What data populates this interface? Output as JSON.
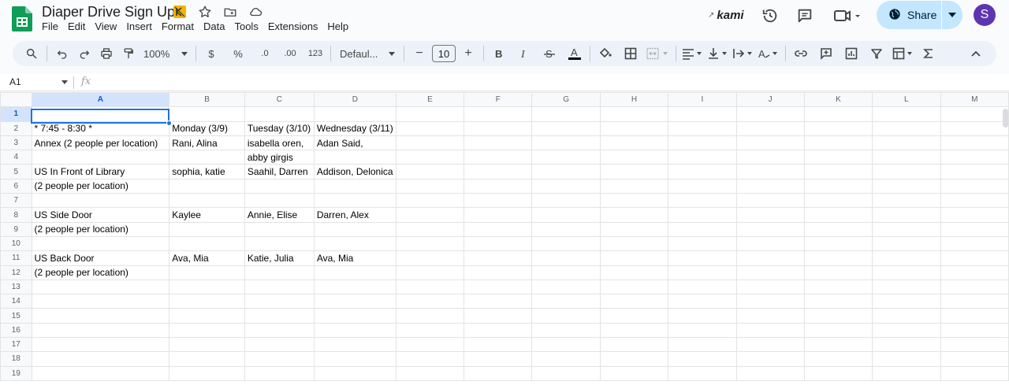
{
  "app": {
    "doc_title": "Diaper Drive Sign Ups",
    "menus": [
      "File",
      "Edit",
      "View",
      "Insert",
      "Format",
      "Data",
      "Tools",
      "Extensions",
      "Help"
    ],
    "kami_label": "kami",
    "share_label": "Share",
    "avatar_letter": "S",
    "accent": "#1a73e8"
  },
  "toolbar": {
    "zoom": "100%",
    "currency": "$",
    "percent": "%",
    "decrease_decimal": ".0",
    "increase_decimal": ".00",
    "number_format": "123",
    "font": "Defaul...",
    "font_size": "10",
    "minus": "−",
    "plus": "+"
  },
  "formula_bar": {
    "name_box": "A1",
    "fx": "fx",
    "value": ""
  },
  "sheet": {
    "columns": [
      "A",
      "B",
      "C",
      "D",
      "E",
      "F",
      "G",
      "H",
      "I",
      "J",
      "K",
      "L",
      "M"
    ],
    "rows": [
      [
        "",
        "",
        "",
        ""
      ],
      [
        "* 7:45 - 8:30 *",
        "Monday (3/9)",
        "Tuesday (3/10)",
        "Wednesday (3/11)"
      ],
      [
        "Annex (2 people per location)",
        "Rani, Alina",
        "isabella oren,",
        "Adan Said,"
      ],
      [
        "",
        "",
        "abby girgis",
        ""
      ],
      [
        "US In Front of Library",
        "sophia, katie",
        "Saahil, Darren",
        "Addison, Delonica"
      ],
      [
        "(2 people per location)",
        "",
        "",
        ""
      ],
      [
        "",
        "",
        "",
        ""
      ],
      [
        "US Side Door",
        "Kaylee",
        "Annie, Elise",
        "Darren, Alex"
      ],
      [
        "(2 people per location)",
        "",
        "",
        ""
      ],
      [
        "",
        "",
        "",
        ""
      ],
      [
        "US Back Door",
        "Ava, Mia",
        "Katie, Julia",
        "Ava, Mia"
      ],
      [
        "(2 people per location)",
        "",
        "",
        ""
      ],
      [
        "",
        "",
        "",
        ""
      ],
      [
        "",
        "",
        "",
        ""
      ],
      [
        "",
        "",
        "",
        ""
      ],
      [
        "",
        "",
        "",
        ""
      ],
      [
        "",
        "",
        "",
        ""
      ],
      [
        "",
        "",
        "",
        ""
      ],
      [
        "",
        "",
        "",
        ""
      ]
    ],
    "row_numbers": [
      "1",
      "2",
      "3",
      "4",
      "5",
      "6",
      "7",
      "8",
      "9",
      "10",
      "11",
      "12",
      "13",
      "14",
      "15",
      "16",
      "17",
      "18",
      "19"
    ]
  }
}
